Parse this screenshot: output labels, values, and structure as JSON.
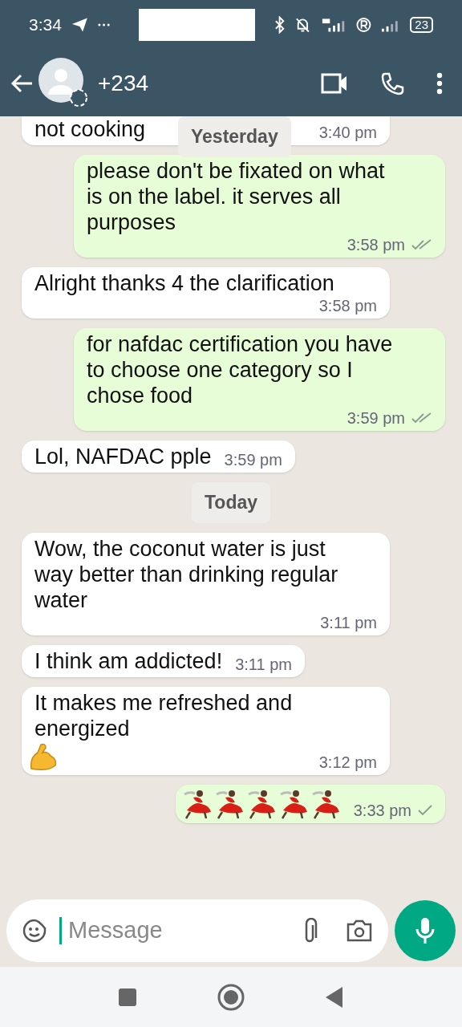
{
  "status_bar": {
    "time": "3:34",
    "battery": "23"
  },
  "header": {
    "contact": "+234"
  },
  "messages": [
    {
      "kind": "message",
      "outgoing": false,
      "text": "not cooking",
      "time": "3:40 pm",
      "cut_top": true
    },
    {
      "kind": "message",
      "outgoing": true,
      "text": "please don't be fixated on what is on the label. it serves all purposes",
      "time": "3:58 pm",
      "read": true
    },
    {
      "kind": "message",
      "outgoing": false,
      "text": "Alright thanks 4 the clarification",
      "time": "3:58 pm"
    },
    {
      "kind": "message",
      "outgoing": true,
      "text": "for nafdac certification you have to choose one category so I chose food",
      "time": "3:59 pm",
      "read": true
    },
    {
      "kind": "message",
      "outgoing": false,
      "text": "Lol, NAFDAC pple",
      "time": "3:59 pm"
    },
    {
      "kind": "date",
      "text": "Today"
    },
    {
      "kind": "message",
      "outgoing": false,
      "text": "Wow, the coconut water is just way better than drinking regular water",
      "time": "3:11 pm"
    },
    {
      "kind": "message",
      "outgoing": false,
      "text": "I think am addicted!",
      "time": "3:11 pm"
    },
    {
      "kind": "message",
      "outgoing": false,
      "text": "It makes me refreshed and energized",
      "time": "3:12 pm",
      "emoji": [
        {
          "kind": "flexed-arm"
        }
      ]
    },
    {
      "kind": "message",
      "outgoing": true,
      "time": "3:33 pm",
      "read": false,
      "emoji": [
        {
          "kind": "dancer"
        },
        {
          "kind": "dancer"
        },
        {
          "kind": "dancer"
        },
        {
          "kind": "dancer"
        },
        {
          "kind": "dancer"
        }
      ]
    }
  ],
  "floating_date": "Yesterday",
  "composer": {
    "placeholder": "Message"
  }
}
